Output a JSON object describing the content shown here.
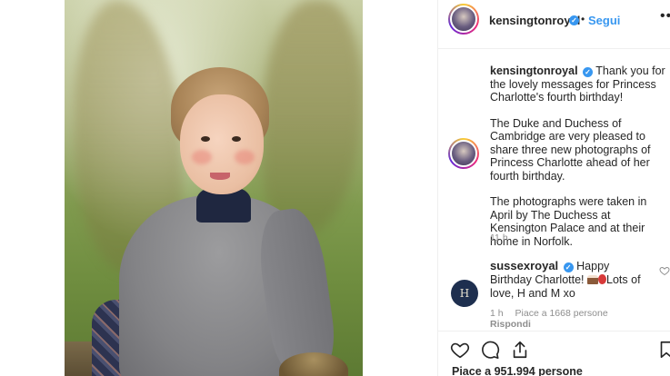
{
  "post": {
    "username": "kensingtonroyal",
    "follow_label": "Segui",
    "more_label": "•••",
    "verified_mark": "✓"
  },
  "caption": {
    "username": "kensingtonroyal",
    "paragraph1": "Thank you for the lovely messages for Princess Charlotte's fourth birthday!",
    "paragraph2": "The Duke and Duchess of Cambridge are very pleased to share three new photographs of Princess Charlotte ahead of her fourth birthday.",
    "paragraph3": "The photographs were taken in April by The Duchess at Kensington Palace and at their home in Norfolk.",
    "time": "11 h"
  },
  "comment": {
    "username": "sussexroyal",
    "text_before": "Happy Birthday Charlotte!",
    "text_after": "Lots of love, H and M xo",
    "avatar_monogram": "H",
    "time": "1 h",
    "likes": "Piace a 1668 persone",
    "reply_label": "Rispondi"
  },
  "footer": {
    "likes": "Piace a 951.994 persone"
  },
  "icons": {
    "like": "heart-icon",
    "comment": "comment-icon",
    "share": "share-icon",
    "save": "bookmark-icon"
  },
  "colors": {
    "link_blue": "#3897f0",
    "muted": "#8e8e8e",
    "text": "#262626"
  }
}
